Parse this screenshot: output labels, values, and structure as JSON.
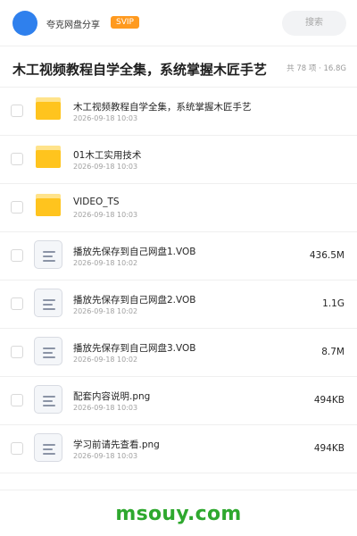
{
  "header": {
    "app_name": "夸克网盘分享",
    "badge": "SVIP",
    "search_placeholder": "搜索",
    "avatar_color": "#2f80ed",
    "badge_color": "#ff9a1f"
  },
  "folder": {
    "title": "木工视频教程自学全集，系统掌握木匠手艺",
    "meta": "共 78 项 · 16.8G"
  },
  "files": [
    {
      "icon": "folder-icon",
      "name": "木工视频教程自学全集，系统掌握木匠手艺",
      "date": "2026-09-18 10:03",
      "size": ""
    },
    {
      "icon": "folder-icon",
      "name": "01木工实用技术",
      "date": "2026-09-18 10:03",
      "size": ""
    },
    {
      "icon": "folder-icon",
      "name": "VIDEO_TS",
      "date": "2026-09-18 10:03",
      "size": ""
    },
    {
      "icon": "document-icon",
      "name": "播放先保存到自己网盘1.VOB",
      "date": "2026-09-18 10:02",
      "size": "436.5M"
    },
    {
      "icon": "document-icon",
      "name": "播放先保存到自己网盘2.VOB",
      "date": "2026-09-18 10:02",
      "size": "1.1G"
    },
    {
      "icon": "document-icon",
      "name": "播放先保存到自己网盘3.VOB",
      "date": "2026-09-18 10:02",
      "size": "8.7M"
    },
    {
      "icon": "document-icon",
      "name": "配套内容说明.png",
      "date": "2026-09-18 10:03",
      "size": "494KB"
    },
    {
      "icon": "document-icon",
      "name": "学习前请先查看.png",
      "date": "2026-09-18 10:03",
      "size": "494KB"
    }
  ],
  "footer": {
    "watermark": "msouy.com",
    "watermark_color": "#2ea82e"
  }
}
